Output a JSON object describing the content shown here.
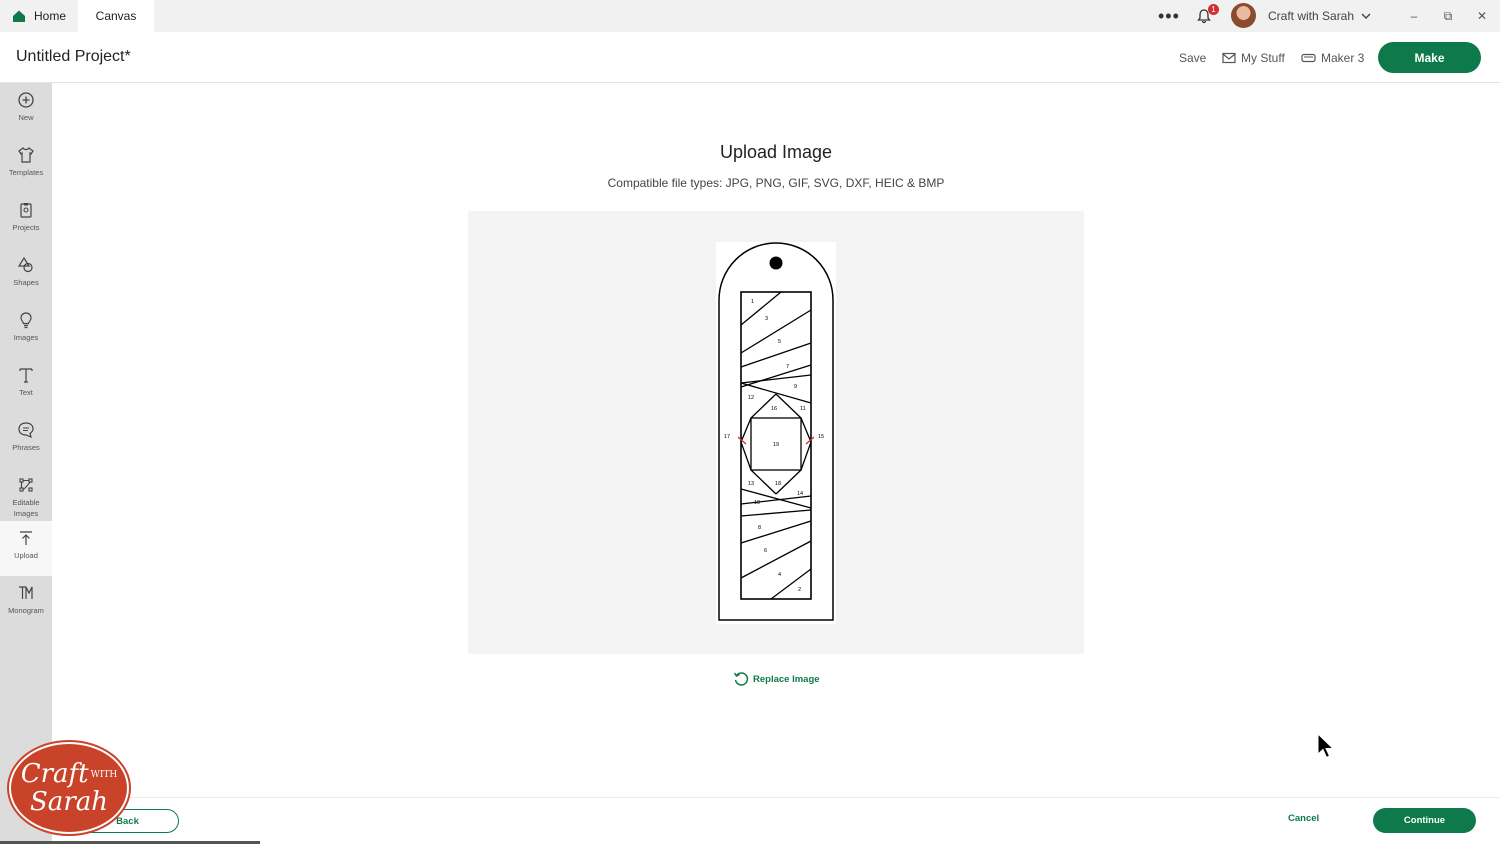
{
  "titlebar": {
    "tabs": [
      {
        "label": "Home",
        "icon": "house-icon"
      },
      {
        "label": "Canvas"
      }
    ],
    "more_label": "•••",
    "notification_count": "1",
    "user_name": "Craft with Sarah",
    "window_controls": {
      "minimize": "–",
      "restore": "⧉",
      "close": "✕"
    }
  },
  "header": {
    "project_title": "Untitled Project*",
    "save_label": "Save",
    "my_stuff_label": "My Stuff",
    "machine_label": "Maker 3",
    "make_label": "Make"
  },
  "sidebar": {
    "items": [
      {
        "label": "New",
        "icon": "plus-circle-icon"
      },
      {
        "label": "Templates",
        "icon": "tshirt-icon"
      },
      {
        "label": "Projects",
        "icon": "clipboard-icon"
      },
      {
        "label": "Shapes",
        "icon": "shapes-icon"
      },
      {
        "label": "Images",
        "icon": "lightbulb-icon"
      },
      {
        "label": "Text",
        "icon": "text-icon"
      },
      {
        "label": "Phrases",
        "icon": "speech-bubble-icon"
      },
      {
        "label": "Editable Images",
        "icon": "edit-vector-icon"
      },
      {
        "label": "Upload",
        "icon": "upload-icon"
      },
      {
        "label": "Monogram",
        "icon": "monogram-icon"
      }
    ]
  },
  "main": {
    "title": "Upload Image",
    "subtitle": "Compatible file types:  JPG, PNG, GIF, SVG, DXF, HEIC & BMP",
    "replace_label": "Replace Image",
    "pattern_numbers": [
      "1",
      "3",
      "5",
      "7",
      "9",
      "12",
      "16",
      "11",
      "17",
      "19",
      "15",
      "13",
      "18",
      "14",
      "10",
      "8",
      "6",
      "4",
      "2"
    ]
  },
  "footer": {
    "back_label": "Back",
    "cancel_label": "Cancel",
    "continue_label": "Continue"
  },
  "logo": {
    "line1": "Craft",
    "with": "WITH",
    "line2": "Sarah"
  },
  "colors": {
    "accent": "#0e7a4b",
    "logo_red": "#c8432a",
    "badge_red": "#d32f2f"
  }
}
